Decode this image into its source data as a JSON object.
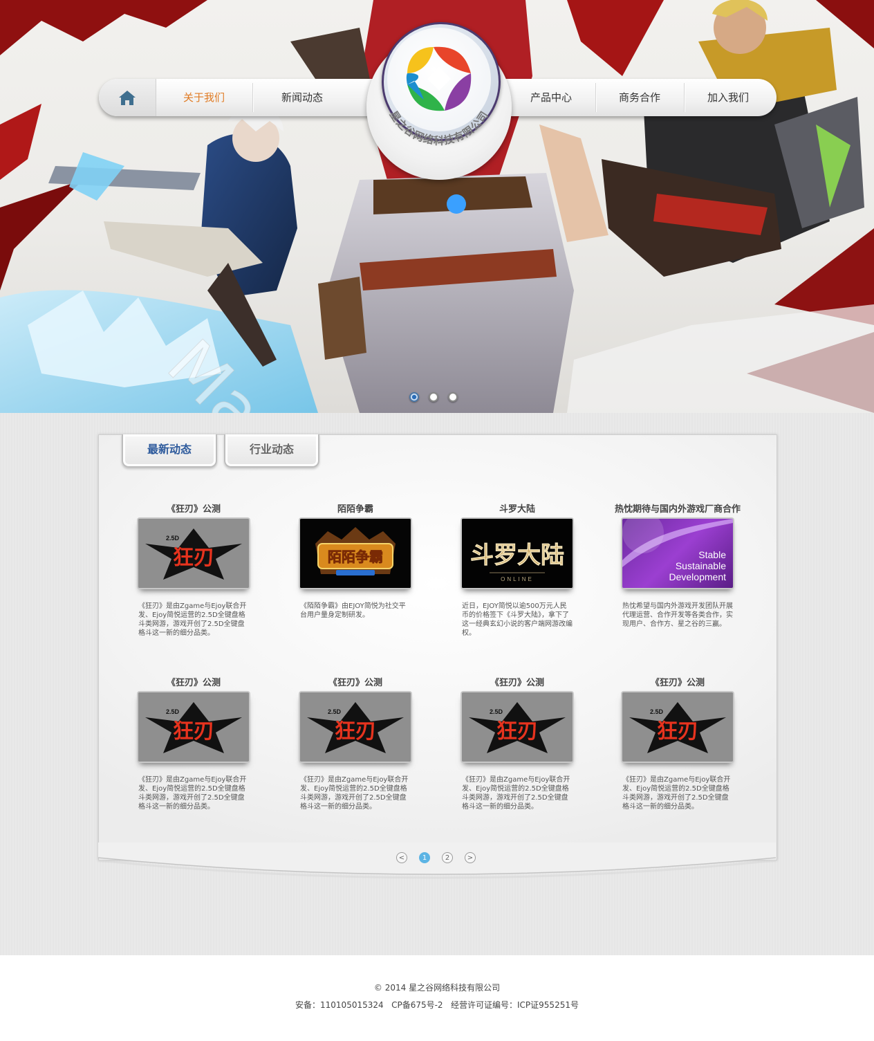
{
  "brand": {
    "company_name": "星之谷网络科技有限公司"
  },
  "nav": {
    "items": [
      "关于我们",
      "新闻动态",
      "产品中心",
      "商务合作",
      "加入我们"
    ],
    "active": "关于我们"
  },
  "watermark": "Marching Grid Young",
  "carousel": {
    "count": 3,
    "active": 1
  },
  "tabs": {
    "latest": "最新动态",
    "industry": "行业动态"
  },
  "cards": [
    {
      "title": "《狂刃》公测",
      "image": "kuangren-logo",
      "desc": "《狂刃》是由Zgame与Ejoy联合开发、Ejoy简悦运营的2.5D全键盘格斗类网游，游戏开创了2.5D全键盘格斗这一新的细分品类。"
    },
    {
      "title": "陌陌争霸",
      "image": "momo-zhengba-logo",
      "desc": "《陌陌争霸》由EJOY简悦为社交平台用户量身定制研发。"
    },
    {
      "title": "斗罗大陆",
      "image": "douluo-dalu-logo",
      "desc": "近日，EJOY简悦以逾500万元人民币的价格签下《斗罗大陆》，拿下了这一经典玄幻小说的客户端网游改编权。"
    },
    {
      "title": "热忱期待与国内外游戏厂商合作",
      "image": "stable-sustainable-development",
      "image_text": [
        "Stable",
        "Sustainable",
        "Development"
      ],
      "desc": "热忱希望与国内外游戏开发团队开展代理运营、合作开发等各类合作，实现用户、合作方、星之谷的三赢。"
    },
    {
      "title": "《狂刃》公测",
      "image": "kuangren-logo",
      "desc": "《狂刃》是由Zgame与Ejoy联合开发、Ejoy简悦运营的2.5D全键盘格斗类网游，游戏开创了2.5D全键盘格斗这一新的细分品类。"
    },
    {
      "title": "《狂刃》公测",
      "image": "kuangren-logo",
      "desc": "《狂刃》是由Zgame与Ejoy联合开发、Ejoy简悦运营的2.5D全键盘格斗类网游，游戏开创了2.5D全键盘格斗这一新的细分品类。"
    },
    {
      "title": "《狂刃》公测",
      "image": "kuangren-logo",
      "desc": "《狂刃》是由Zgame与Ejoy联合开发、Ejoy简悦运营的2.5D全键盘格斗类网游，游戏开创了2.5D全键盘格斗这一新的细分品类。"
    },
    {
      "title": "《狂刃》公测",
      "image": "kuangren-logo",
      "desc": "《狂刃》是由Zgame与Ejoy联合开发、Ejoy简悦运营的2.5D全键盘格斗类网游，游戏开创了2.5D全键盘格斗这一新的细分品类。"
    }
  ],
  "pager": {
    "prev": "<",
    "pages": [
      "1",
      "2"
    ],
    "next": ">",
    "current": "1"
  },
  "footer": {
    "copyright": "© 2014 星之谷网络科技有限公司",
    "license": "安备：110105015324   CP备675号-2   经营许可证编号：ICP证955251号"
  },
  "colors": {
    "nav_active": "#e07b24",
    "tab_active": "#2d5a9c",
    "pager_active": "#5cb4e4"
  }
}
